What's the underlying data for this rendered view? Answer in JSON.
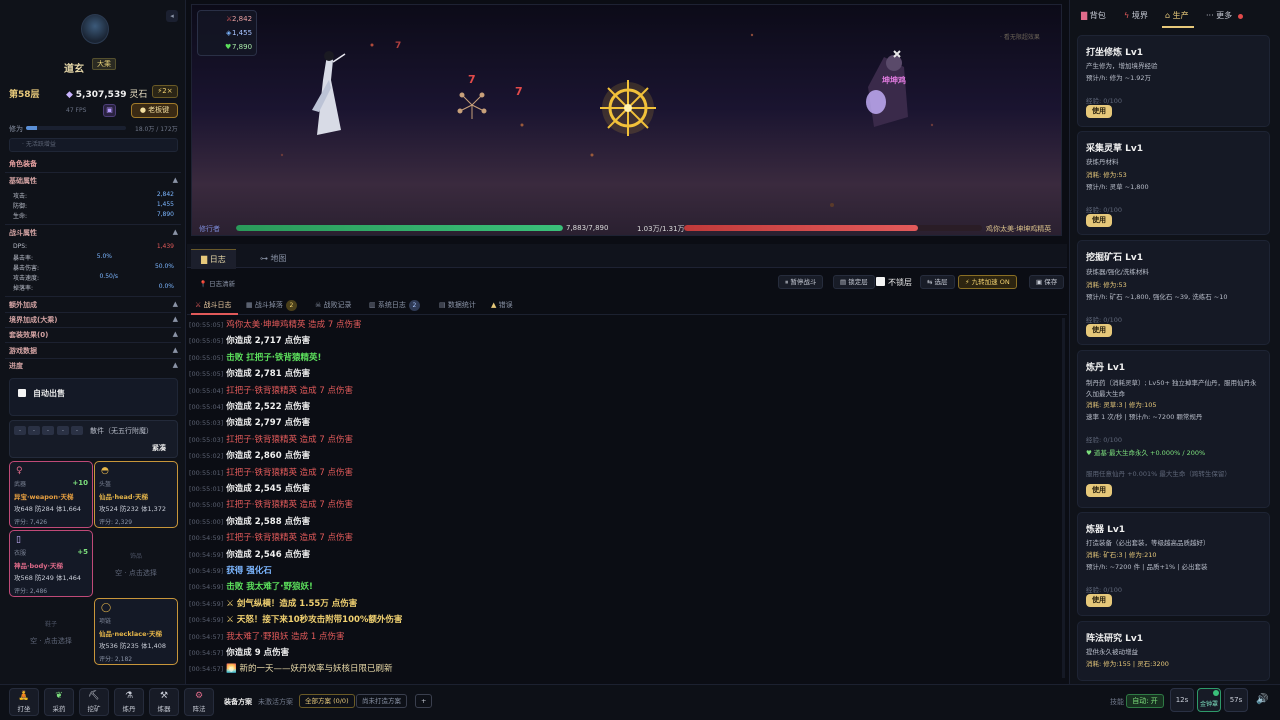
{
  "player": {
    "name": "道玄",
    "rank": "大乘",
    "floor": "第58层",
    "stone_value": "5,307,539",
    "stone_label": "灵石",
    "speed": "2×",
    "fps": "47 FPS",
    "boss_button": "老板键",
    "cultivation_label": "修为",
    "cultivation_value": "18.0万 / 172万",
    "cultivation_fraction": 0.105,
    "buff_empty": "无活跃增益"
  },
  "panel": {
    "equip_title": "角色装备",
    "base_attr": "基础属性",
    "attack_label": "攻击:",
    "attack": "2,842",
    "defense_label": "防御:",
    "defense": "1,455",
    "hp_label": "生命:",
    "hp": "7,890",
    "battle_attr": "战斗属性",
    "dps_label": "DPS:",
    "dps": "1,439",
    "crit_rate_label": "暴击率:",
    "crit_rate": "5.0%",
    "crit_dmg_label": "暴击伤害:",
    "crit_dmg": "50.0%",
    "atk_speed_label": "攻击速度:",
    "atk_speed": "0.50/s",
    "drop_rate_label": "掉落率:",
    "drop_rate": "0.0%",
    "extra_bonus": "额外加成",
    "realm_bonus": "境界加成(大乘)",
    "set_effect": "套装效果(0)",
    "game_data": "游戏数据",
    "progress": "进度",
    "auto_fight": "自动出售",
    "filter_label": "散件（无五行附魔）",
    "tighten": "紧凑"
  },
  "equipment": [
    {
      "slot": "武器",
      "plus": "+10",
      "name": "异宝·weapon·天梯",
      "stats": "攻648 防284 体1,664",
      "score": "评分: 7,426",
      "color": "#e06b8a"
    },
    {
      "slot": "头盔",
      "plus": "",
      "name": "仙品·head·天梯",
      "stats": "攻524 防232 体1,372",
      "score": "评分: 2,329",
      "color": "#e6b64a"
    },
    {
      "slot": "衣服",
      "plus": "+5",
      "name": "神品·body·天梯",
      "stats": "攻568 防249 体1,464",
      "score": "评分: 2,486",
      "color": "#e06b8a"
    },
    {
      "slot": "饰品",
      "empty": "空 · 点击选择"
    },
    {
      "slot": "鞋子",
      "empty": "空 · 点击选择"
    },
    {
      "slot": "项链",
      "plus": "",
      "name": "仙品·necklace·天梯",
      "stats": "攻536 防235 体1,408",
      "score": "评分: 2,182",
      "color": "#e6b64a"
    }
  ],
  "arena": {
    "atk": "2,842",
    "def": "1,455",
    "hp": "7,890",
    "tip": "· 看无限超效果",
    "player_label": "修行者",
    "player_hp": "7,883/7,890",
    "player_hp_fraction": 0.999,
    "enemy_hp": "1.03万/1.31万",
    "enemy_hp_fraction": 0.786,
    "enemy_name": "鸡你太美·坤坤鸡精英",
    "enemy_tag": "坤坤鸡",
    "dmg1": "7",
    "dmg2": "7",
    "dmg3": "7"
  },
  "log_tabs": {
    "log": "日志",
    "map": "地图"
  },
  "toolbar": {
    "log_clean": "日志清新",
    "pause": "暂停战斗",
    "lock": "锁定层",
    "no_lock": "不锁层",
    "select": "选层",
    "nine_speed": "九转加速 ON",
    "save": "保存"
  },
  "subtabs": {
    "battle": "战斗日志",
    "battle_badge": "",
    "loot": "战斗掉落",
    "loot_badge": "2",
    "defeat": "战败记录",
    "system": "系统日志",
    "system_badge": "2",
    "stats": "数据统计",
    "errors": "错误"
  },
  "log": [
    {
      "t": "[00:55:05]",
      "m": "鸡你太美·坤坤鸡精英 造成 7 点伤害",
      "c": "red"
    },
    {
      "t": "[00:55:05]",
      "m": "你造成 2,717 点伤害",
      "c": "w"
    },
    {
      "t": "[00:55:05]",
      "m": "击败 扛把子·铁背猿精英!",
      "c": "g"
    },
    {
      "t": "[00:55:05]",
      "m": "你造成 2,781 点伤害",
      "c": "w"
    },
    {
      "t": "[00:55:04]",
      "m": "扛把子·铁背猿精英 造成 7 点伤害",
      "c": "red"
    },
    {
      "t": "[00:55:04]",
      "m": "你造成 2,522 点伤害",
      "c": "w"
    },
    {
      "t": "[00:55:03]",
      "m": "你造成 2,797 点伤害",
      "c": "w"
    },
    {
      "t": "[00:55:03]",
      "m": "扛把子·铁背猿精英 造成 7 点伤害",
      "c": "red"
    },
    {
      "t": "[00:55:02]",
      "m": "你造成 2,860 点伤害",
      "c": "w"
    },
    {
      "t": "[00:55:01]",
      "m": "扛把子·铁背猿精英 造成 7 点伤害",
      "c": "red"
    },
    {
      "t": "[00:55:01]",
      "m": "你造成 2,545 点伤害",
      "c": "w"
    },
    {
      "t": "[00:55:00]",
      "m": "扛把子·铁背猿精英 造成 7 点伤害",
      "c": "red"
    },
    {
      "t": "[00:55:00]",
      "m": "你造成 2,588 点伤害",
      "c": "w"
    },
    {
      "t": "[00:54:59]",
      "m": "扛把子·铁背猿精英 造成 7 点伤害",
      "c": "red"
    },
    {
      "t": "[00:54:59]",
      "m": "你造成 2,546 点伤害",
      "c": "w"
    },
    {
      "t": "[00:54:59]",
      "m": "获得 强化石",
      "c": "b"
    },
    {
      "t": "[00:54:59]",
      "m": "击败 我太难了·野狼妖!",
      "c": "g"
    },
    {
      "t": "[00:54:59]",
      "m": "⚔ 剑气纵横！造成 1.55万 点伤害",
      "c": "y"
    },
    {
      "t": "[00:54:59]",
      "m": "⚔ 天怒！接下来10秒攻击附带100%额外伤害",
      "c": "y"
    },
    {
      "t": "[00:54:57]",
      "m": "我太难了·野狼妖 造成 1 点伤害",
      "c": "red"
    },
    {
      "t": "[00:54:57]",
      "m": "你造成 9 点伤害",
      "c": "w"
    },
    {
      "t": "[00:54:57]",
      "m": "🌅 新的一天——妖丹效率与妖核日限已刷新",
      "c": "ev"
    }
  ],
  "right_tabs": {
    "bag": "背包",
    "realm": "境界",
    "produce": "生产",
    "more": "··· 更多"
  },
  "cards": [
    {
      "title": "打坐修炼 Lv1",
      "l1": "产生修为，增加境界经验",
      "l2": "预计/h: 修为 ~1.92万",
      "exp": "经验: 0/100",
      "use": "使用"
    },
    {
      "title": "采集灵草 Lv1",
      "l1": "获炼丹材料",
      "l2": "消耗: 修为:53",
      "l3": "预计/h: 灵草 ~1,800",
      "exp": "经验: 0/100",
      "use": "使用"
    },
    {
      "title": "挖掘矿石 Lv1",
      "l1": "获炼器/强化/洗练材料",
      "l2": "消耗: 修为:53",
      "l3": "预计/h: 矿石 ~1,800, 强化石 ~39, 洗练石 ~10",
      "exp": "经验: 0/100",
      "use": "使用"
    },
    {
      "title": "炼丹 Lv1",
      "l1": "制丹药（消耗灵草）; Lv50+ 独立掉率产仙丹，服用仙丹永",
      "l1b": "久加最大生命",
      "l2": "消耗: 灵草:3 | 修为:105",
      "l3": "速率 1 次/秒 | 预计/h: ~7200 颗常规丹",
      "exp": "经验: 0/100",
      "perm": "道基·最大生命永久 +0.000% / 200%",
      "hint": "服用任意仙丹 +0.001% 最大生命（跨转生保留）",
      "use": "使用"
    },
    {
      "title": "炼器 Lv1",
      "l1": "打造装备（必出套装，等级越高品质越好）",
      "l2": "消耗: 矿石:3 | 修为:210",
      "l3": "预计/h: ~7200 件 | 品质+1% | 必出套装",
      "exp": "经验: 0/100",
      "use": "使用"
    },
    {
      "title": "阵法研究 Lv1",
      "l1": "提供永久被动增益",
      "l2": "消耗: 修为:155 | 灵石:3200"
    }
  ],
  "bottom": {
    "b1": "打坐",
    "b2": "采药",
    "b3": "挖矿",
    "b4": "炼丹",
    "b5": "炼器",
    "b6": "阵法",
    "eq_plan": "装备方案",
    "eq_none": "未激活方案",
    "all_plan": "全部方案 (0/0)",
    "unforged": "尚未打造方案",
    "add": "+",
    "skill_label": "技能",
    "auto_on": "自动: 开",
    "s1": "12s",
    "s2": "金钟罩",
    "s3": "57s"
  }
}
